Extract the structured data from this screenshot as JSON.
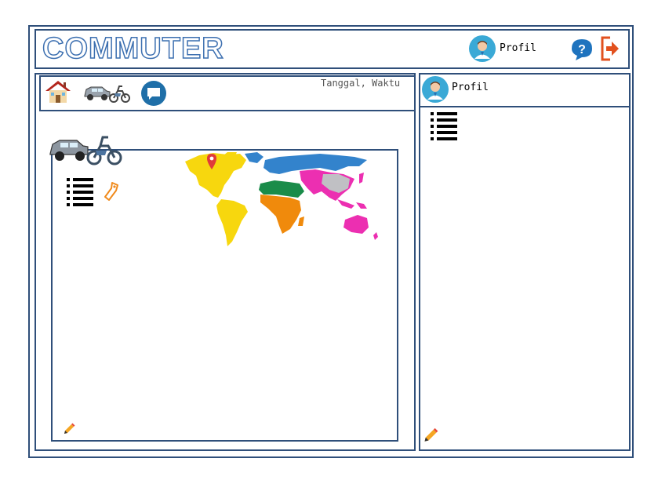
{
  "app": {
    "title": "COMMUTER"
  },
  "header": {
    "profile_label": "Profil",
    "help_icon": "help-icon",
    "logout_icon": "logout-icon"
  },
  "toolbar": {
    "datetime": "Tanggal, Waktu",
    "icons": [
      "home-icon",
      "vehicles-icon",
      "chat-icon"
    ]
  },
  "sidebar": {
    "profile_label": "Profil"
  },
  "colors": {
    "border": "#2f4f7a",
    "accent": "#3aa9d6",
    "logout": "#e2511f"
  }
}
